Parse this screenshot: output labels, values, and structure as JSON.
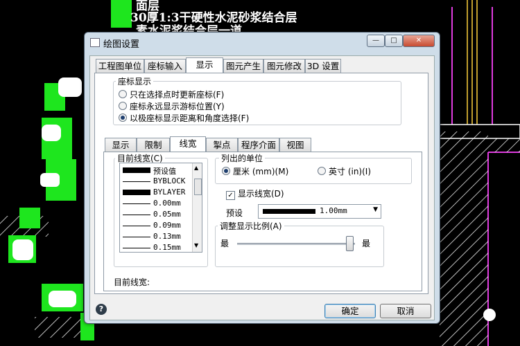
{
  "background": {
    "note_lines": [
      "面层",
      "30厚1:3干硬性水泥砂浆结合层",
      "素水泥浆结合层一道"
    ]
  },
  "dialog": {
    "title": "绘图设置",
    "window_buttons": {
      "minimize": "—",
      "maximize": "□",
      "close": "✕"
    },
    "top_tabs": [
      "工程图单位",
      "座标输入",
      "显示",
      "图元产生",
      "图元修改",
      "3D 设置"
    ],
    "active_top_tab": "显示",
    "coord_group": {
      "label": "座标显示",
      "options": [
        "只在选择点时更新座标(F)",
        "座标永远显示游标位置(Y)",
        "以极座标显示距离和角度选择(F)"
      ],
      "selected_index": 2
    },
    "sub_tabs": [
      "显示",
      "限制",
      "线宽",
      "掣点",
      "程序介面",
      "视图"
    ],
    "active_sub_tab": "线宽",
    "lineweight_group": {
      "label": "目前线宽(C)",
      "items": [
        {
          "label": "预设值",
          "thick": true
        },
        {
          "label": "BYBLOCK",
          "thick": false
        },
        {
          "label": "BYLAYER",
          "thick": true
        },
        {
          "label": "0.00mm",
          "thick": false
        },
        {
          "label": "0.05mm",
          "thick": false
        },
        {
          "label": "0.09mm",
          "thick": false
        },
        {
          "label": "0.13mm",
          "thick": false
        },
        {
          "label": "0.15mm",
          "thick": false
        }
      ]
    },
    "units_group": {
      "label": "列出的单位",
      "options": [
        "厘米 (mm)(M)",
        "英寸 (in)(I)"
      ],
      "selected_index": 0
    },
    "show_lineweight": {
      "label": "显示线宽(D)",
      "checked": true
    },
    "preset": {
      "label": "预设",
      "value": "1.00mm"
    },
    "scale_group": {
      "label": "调整显示比例(A)",
      "min_label": "最",
      "max_label": "最",
      "slider_fraction": 0.95
    },
    "current_lineweight_label": "目前线宽:",
    "ok": "确定",
    "cancel": "取消",
    "help": "?"
  }
}
